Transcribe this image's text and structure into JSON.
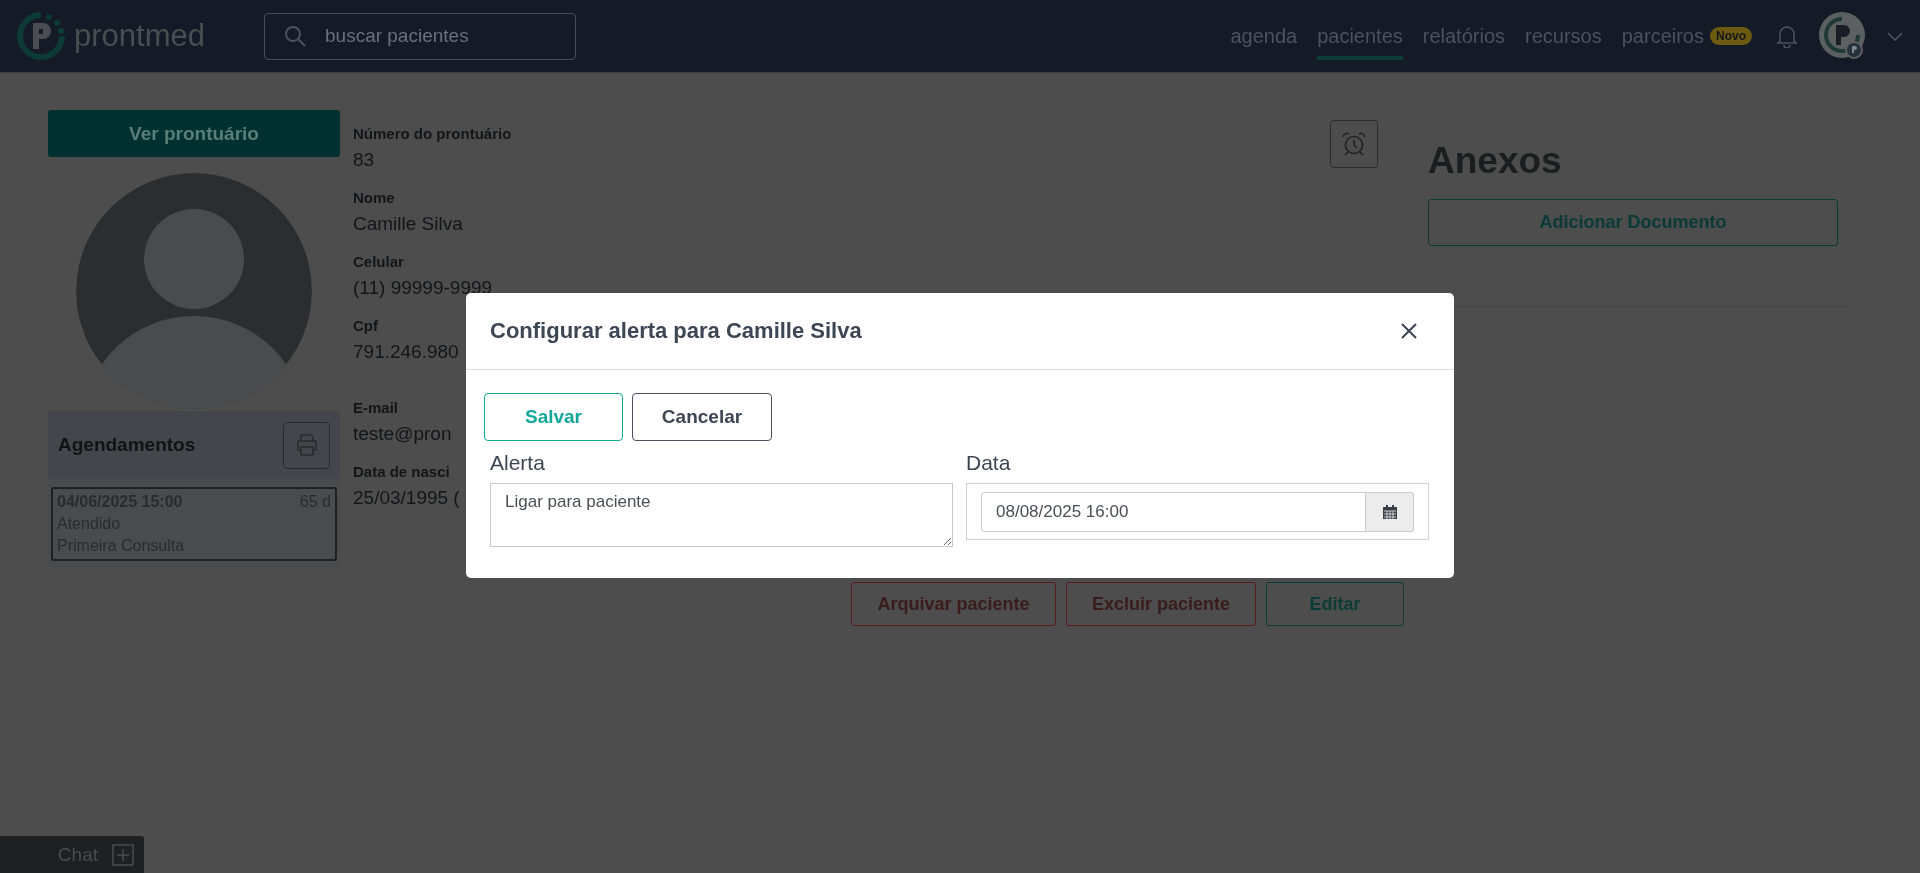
{
  "nav": {
    "logo": "prontmed",
    "search": {
      "placeholder": "buscar pacientes"
    },
    "links": [
      {
        "label": "agenda",
        "selected": false
      },
      {
        "label": "pacientes",
        "selected": true
      },
      {
        "label": "relatórios",
        "selected": false
      },
      {
        "label": "recursos",
        "selected": false
      },
      {
        "label": "parceiros",
        "selected": false,
        "badge": "Novo"
      }
    ]
  },
  "patient": {
    "record_button": "Ver prontuário",
    "fields": [
      {
        "label": "Número do prontuário",
        "value": "83"
      },
      {
        "label": "Nome",
        "value": "Camille Silva"
      },
      {
        "label": "Celular",
        "value": "(11) 99999-9999"
      },
      {
        "label": "Cpf",
        "value": "791.246.980"
      },
      {
        "label": "E-mail",
        "value": "teste@pron"
      },
      {
        "label": "Data de nasci",
        "value": "25/03/1995 ("
      }
    ],
    "appointments": {
      "title": "Agendamentos",
      "items": [
        {
          "datetime": "04/06/2025 15:00",
          "ago": "65 d",
          "status": "Atendido",
          "type": "Primeira Consulta"
        }
      ]
    }
  },
  "attachments": {
    "title": "Anexos",
    "button": "Adicionar Documento"
  },
  "actions": [
    {
      "label": "Arquivar paciente",
      "kind": "danger"
    },
    {
      "label": "Excluir paciente",
      "kind": "danger"
    },
    {
      "label": "Editar",
      "kind": "primary"
    }
  ],
  "modal": {
    "title": "Configurar alerta para Camille Silva",
    "buttons": [
      {
        "label": "Salvar",
        "kind": "primary"
      },
      {
        "label": "Cancelar",
        "kind": "secondary"
      }
    ],
    "alert": {
      "label": "Alerta",
      "value": "Ligar para paciente"
    },
    "date": {
      "label": "Data",
      "value": "08/08/2025 16:00"
    }
  },
  "chat": {
    "label": "Chat"
  }
}
